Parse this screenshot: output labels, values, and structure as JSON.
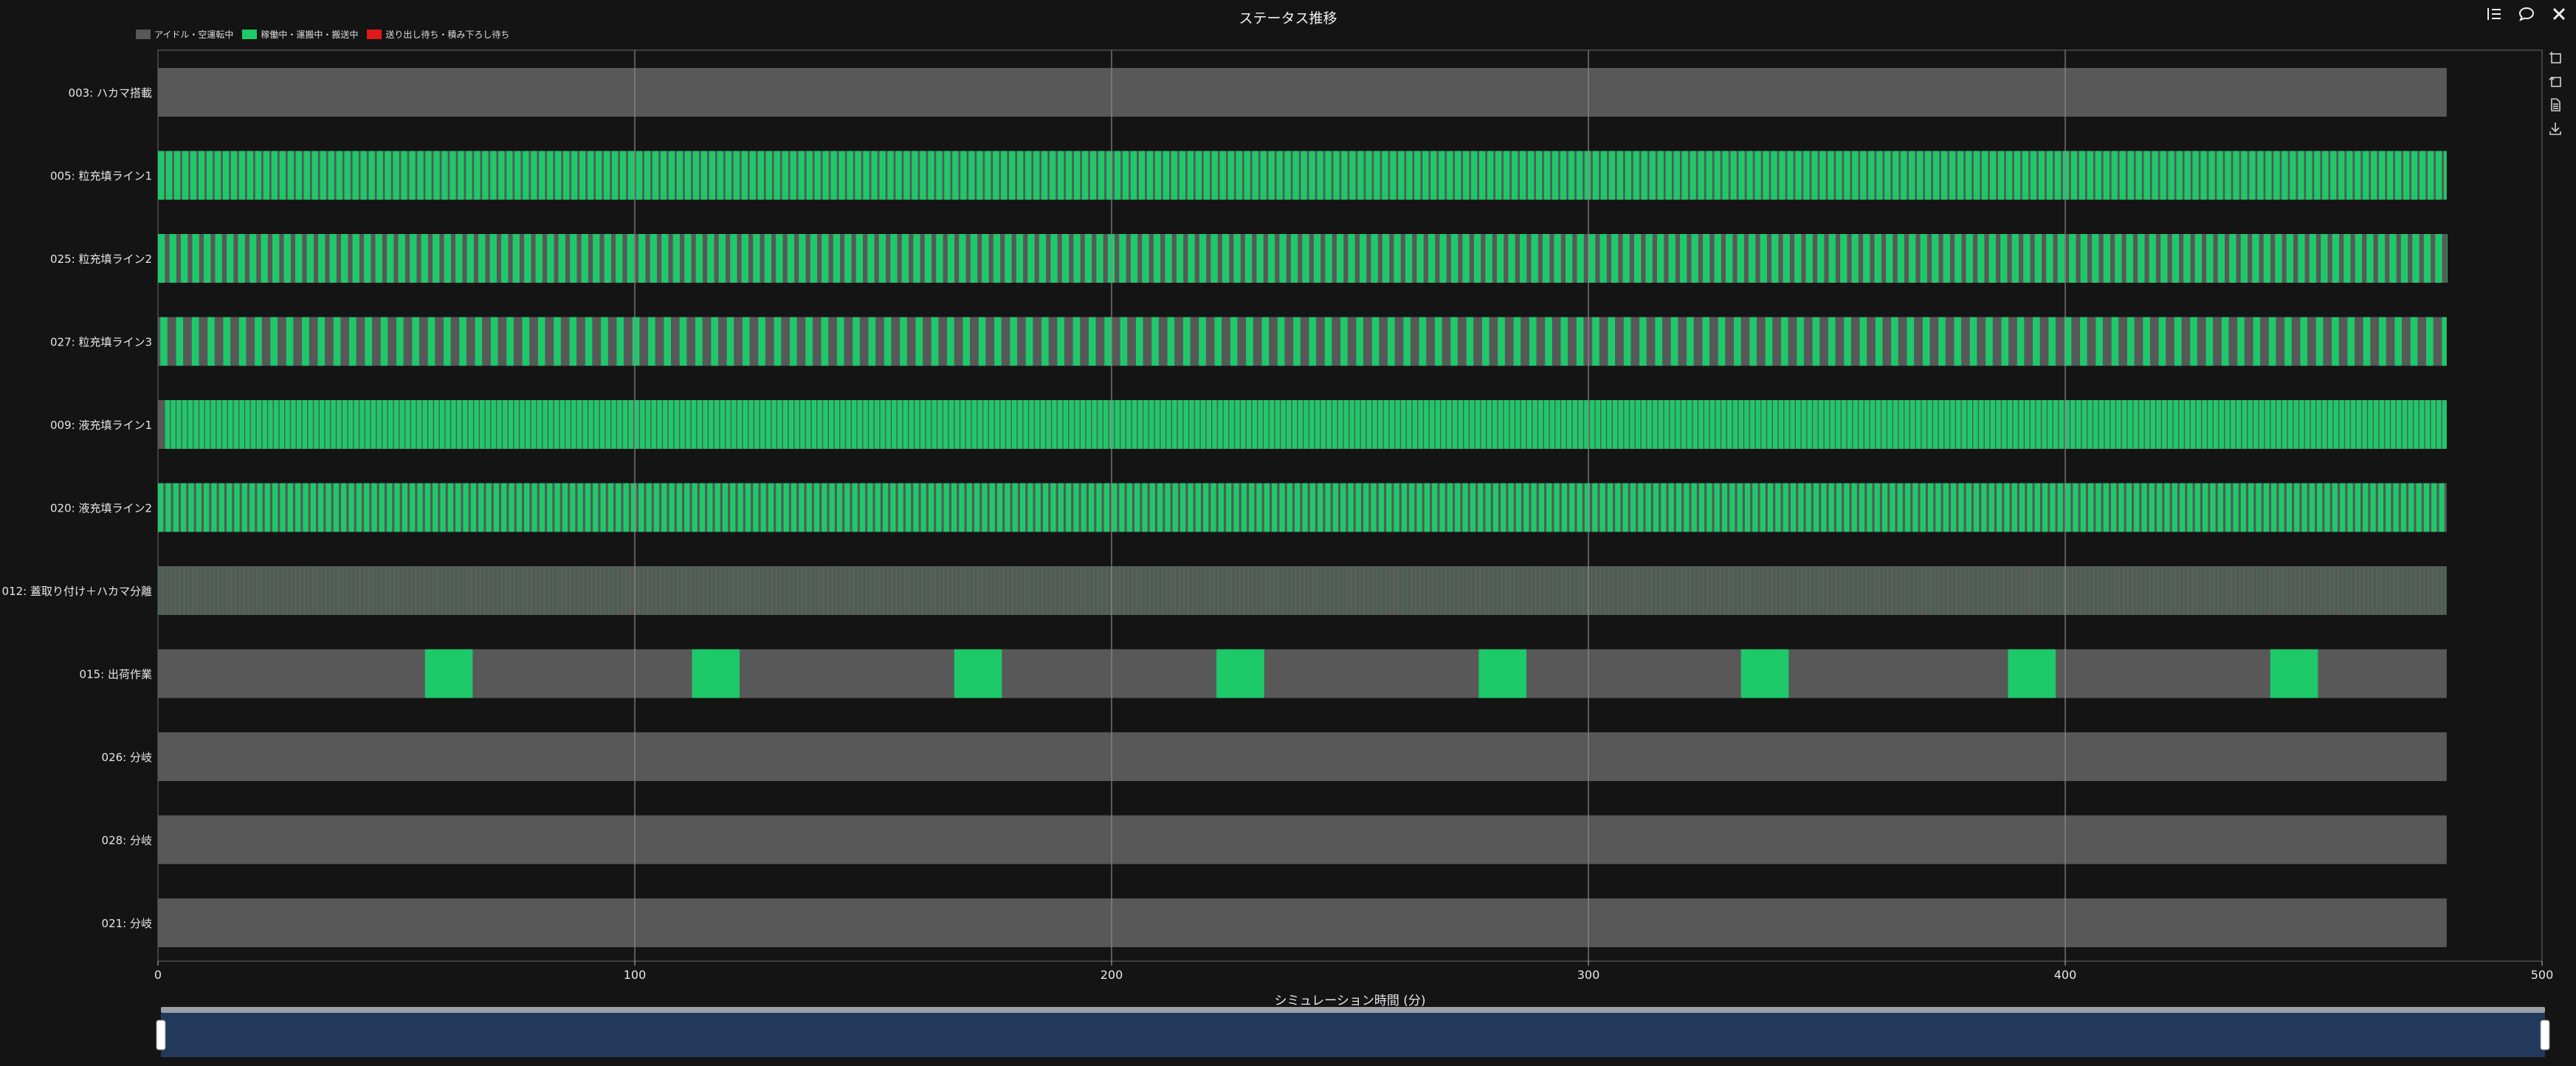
{
  "window": {
    "title": "ステータス推移",
    "buttons": [
      {
        "name": "list-icon",
        "glyph": "☷"
      },
      {
        "name": "comment-icon",
        "glyph": "💬"
      },
      {
        "name": "close-icon",
        "glyph": "✕"
      }
    ]
  },
  "legend": [
    {
      "label": "アイドル・空運転中",
      "color": "#585858"
    },
    {
      "label": "稼働中・運搬中・搬送中",
      "color": "#1ec96a"
    },
    {
      "label": "送り出し待ち・積み下ろし待ち",
      "color": "#e01a1a"
    }
  ],
  "toolbar": [
    {
      "name": "zoom-in-icon"
    },
    {
      "name": "zoom-reset-icon"
    },
    {
      "name": "document-icon"
    },
    {
      "name": "download-icon"
    }
  ],
  "colors": {
    "background": "#141414",
    "plot_bg": "#141414",
    "idle": "#585858",
    "busy": "#1ec96a",
    "blocked": "#e01a1a",
    "grid": "#5a5a5a",
    "slider_fill": "#23395b"
  },
  "chart_data": {
    "type": "timeline",
    "xlabel": "シミュレーション時間 (分)",
    "xlim": [
      0,
      500
    ],
    "xticks": [
      0,
      100,
      200,
      300,
      400,
      500
    ],
    "sim_end": 480,
    "grid": "vertical",
    "legend_position": "top-left",
    "rows": [
      {
        "label": "003: ハカマ搭載",
        "pattern": "idle"
      },
      {
        "label": "005: 粒充填ライン1",
        "pattern": "periodic",
        "period": 1.7,
        "busy_fraction": 0.75,
        "start": 0
      },
      {
        "label": "025: 粒充填ライン2",
        "pattern": "periodic",
        "period": 2.4,
        "busy_fraction": 0.6,
        "start": 0
      },
      {
        "label": "027: 粒充填ライン3",
        "pattern": "periodic",
        "period": 3.3,
        "busy_fraction": 0.45,
        "start": 0.5
      },
      {
        "label": "009: 液充填ライン1",
        "pattern": "periodic",
        "period": 1.2,
        "busy_fraction": 0.82,
        "start": 1.5
      },
      {
        "label": "020: 液充填ライン2",
        "pattern": "periodic",
        "period": 1.6,
        "busy_fraction": 0.7,
        "start": 0
      },
      {
        "label": "012: 蓋取り付け＋ハカマ分離",
        "pattern": "periodic",
        "period": 0.9,
        "busy_fraction": 0.15,
        "start": 0,
        "dim": true
      },
      {
        "label": "015: 出荷作業",
        "pattern": "intervals",
        "intervals": [
          [
            56,
            66
          ],
          [
            112,
            122
          ],
          [
            167,
            177
          ],
          [
            222,
            232
          ],
          [
            277,
            287
          ],
          [
            332,
            342
          ],
          [
            388,
            398
          ],
          [
            443,
            453
          ]
        ]
      },
      {
        "label": "026: 分岐",
        "pattern": "idle"
      },
      {
        "label": "028: 分岐",
        "pattern": "idle"
      },
      {
        "label": "021: 分岐",
        "pattern": "idle"
      }
    ],
    "zoom_range": [
      0,
      500
    ]
  }
}
